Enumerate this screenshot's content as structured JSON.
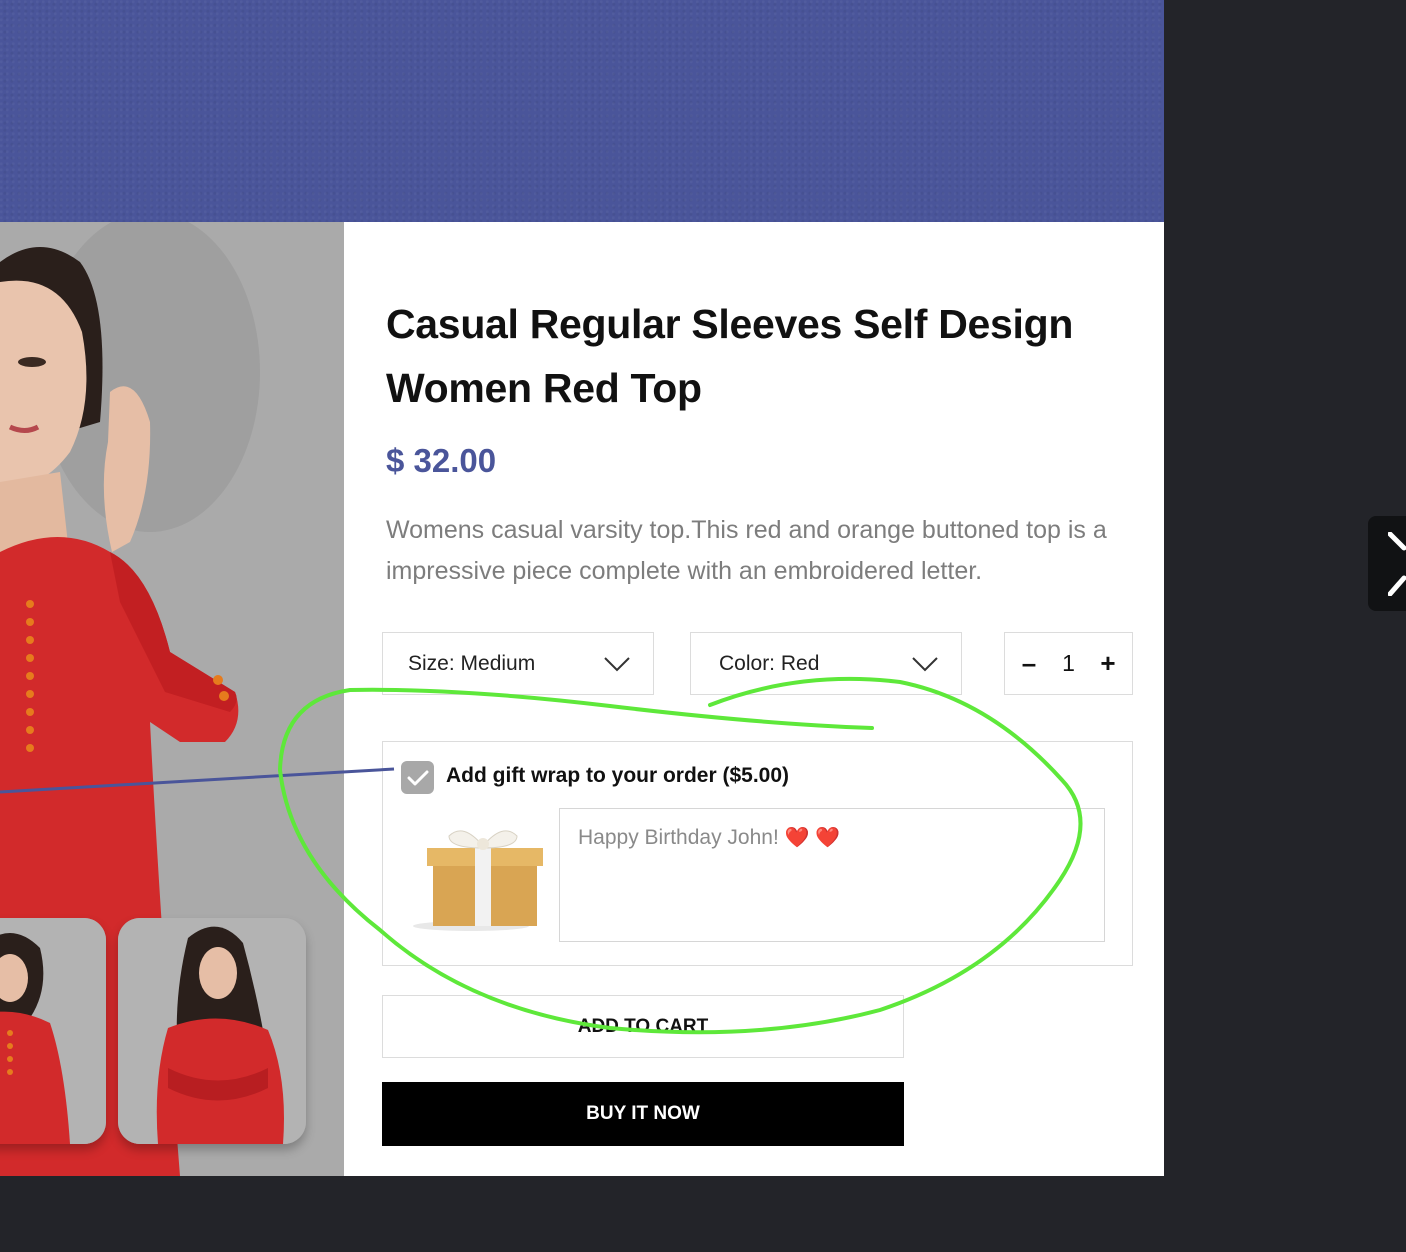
{
  "product": {
    "title": "Casual Regular Sleeves Self Design Women Red Top",
    "price": "$ 32.00",
    "description": "Womens casual varsity top.This red and orange buttoned top is a impressive piece complete with an embroidered letter."
  },
  "options": {
    "size_label": "Size: Medium",
    "color_label": "Color: Red",
    "quantity": "1",
    "minus": "–",
    "plus": "+"
  },
  "gift": {
    "label": "Add gift wrap to your order ($5.00)",
    "checked": true,
    "message": "Happy Birthday John!",
    "hearts": "❤️ ❤️"
  },
  "buttons": {
    "add_to_cart": "ADD TO CART",
    "buy_now": "BUY IT NOW"
  },
  "colors": {
    "brand": "#4a559a",
    "annotation": "#5ee83a",
    "background": "#232429"
  },
  "icons": [
    "chevron-down-icon",
    "check-icon",
    "gift-box-icon",
    "expand-icon"
  ]
}
